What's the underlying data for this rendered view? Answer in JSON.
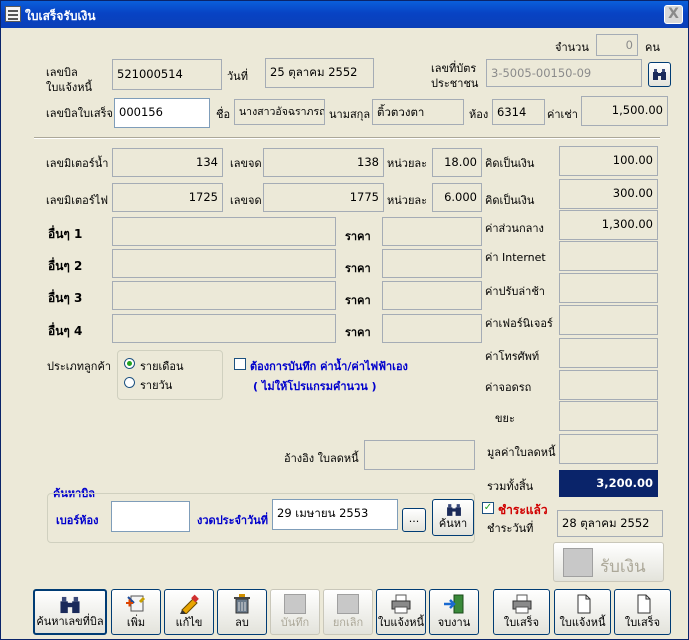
{
  "window": {
    "title": "ใบเสร็จรับเงิน",
    "close_glyph": "X"
  },
  "header": {
    "count_label": "จำนวน",
    "count_value": "0",
    "count_unit": "คน",
    "invoice_no_label_1": "เลขบิล",
    "invoice_no_label_2": "ใบแจ้งหนี้",
    "invoice_no": "521000514",
    "date_label": "วันที่",
    "date_value": "25 ตุลาคม 2552",
    "id_card_label_1": "เลขที่บัตร",
    "id_card_label_2": "ประชาชน",
    "id_card_value": "3-5005-00150-09",
    "receipt_no_label": "เลขบิลใบเสร็จ",
    "receipt_no": "000156",
    "name_label": "ชื่อ",
    "name_value": "นางสาวอัจฉราภรณ์",
    "surname_label": "นามสกุล",
    "surname_value": "ติ้วตวงตา",
    "room_label": "ห้อง",
    "room_value": "6314",
    "rent_label": "ค่าเช่า",
    "rent_value": "1,500.00"
  },
  "meters": {
    "water_label": "เลขมิเตอร์น้ำ",
    "water_prev": "134",
    "water_unit_label": "เลขจด",
    "water_curr": "138",
    "water_rate_label": "หน่วยละ",
    "water_rate": "18.00",
    "water_amount_label": "คิดเป็นเงิน",
    "water_amount": "100.00",
    "elec_label": "เลขมิเตอร์ไฟ",
    "elec_prev": "1725",
    "elec_unit_label": "เลขจด",
    "elec_curr": "1775",
    "elec_rate_label": "หน่วยละ",
    "elec_rate": "6.000",
    "elec_amount_label": "คิดเป็นเงิน",
    "elec_amount": "300.00"
  },
  "others": [
    {
      "label": "อื่นๆ 1",
      "price_label": "ราคา"
    },
    {
      "label": "อื่นๆ 2",
      "price_label": "ราคา"
    },
    {
      "label": "อื่นๆ 3",
      "price_label": "ราคา"
    },
    {
      "label": "อื่นๆ 4",
      "price_label": "ราคา"
    }
  ],
  "fees": {
    "common_label": "ค่าส่วนกลาง",
    "common_value": "1,300.00",
    "internet_label": "ค่า Internet",
    "late_label": "ค่าปรับล่าช้า",
    "furniture_label": "ค่าเฟอร์นิเจอร์",
    "phone_label": "ค่าโทรศัพท์",
    "parking_label": "ค่าจอดรถ",
    "trash_label": "ขยะ",
    "prev_debt_label": "มูลค่าใบลดหนี้",
    "total_label": "รวมทั้งสิ้น",
    "total_value": "3,200.00",
    "paid_label": "ชำระแล้ว",
    "paid_date_label": "ชำระวันที่",
    "paid_date_value": "28 ตุลาคม 2552"
  },
  "customer_type": {
    "label": "ประเภทลูกค้า",
    "monthly": "รายเดือน",
    "daily": "รายวัน",
    "selected": "monthly"
  },
  "manual_record": {
    "line1": "ต้องการบันทึก ค่าน้ำ/ค่าไฟฟ้าเอง",
    "line2": "( ไม่ให้โปรแกรมคำนวน )"
  },
  "reference": {
    "label": "อ้างอิง ใบลดหนี้"
  },
  "search": {
    "title": "ค้นหาบิล",
    "room_label": "เบอร์ห้อง",
    "period_label": "งวดประจำวันที่",
    "period_value": "29 เมษายน 2553",
    "dots": "...",
    "search_button": "ค้นหา"
  },
  "receive_button": "รับเงิน",
  "toolbar": [
    {
      "label": "ค้นหาเลขที่บิล",
      "icon": "binoculars-icon",
      "enabled": true
    },
    {
      "label": "เพิ่ม",
      "icon": "add-icon",
      "enabled": true
    },
    {
      "label": "แก้ไข",
      "icon": "edit-icon",
      "enabled": true
    },
    {
      "label": "ลบ",
      "icon": "delete-icon",
      "enabled": true
    },
    {
      "label": "บันทึก",
      "icon": "save-icon",
      "enabled": false
    },
    {
      "label": "ยกเลิก",
      "icon": "cancel-icon",
      "enabled": false
    },
    {
      "label": "ใบแจ้งหนี้",
      "icon": "printer-icon",
      "enabled": true
    },
    {
      "label": "จบงาน",
      "icon": "exit-icon",
      "enabled": true
    }
  ],
  "print_buttons": [
    {
      "label": "ใบเสร็จ",
      "icon": "printer-icon"
    },
    {
      "label": "ใบแจ้งหนี้",
      "icon": "document-icon"
    },
    {
      "label": "ใบเสร็จ",
      "icon": "document-icon"
    }
  ]
}
